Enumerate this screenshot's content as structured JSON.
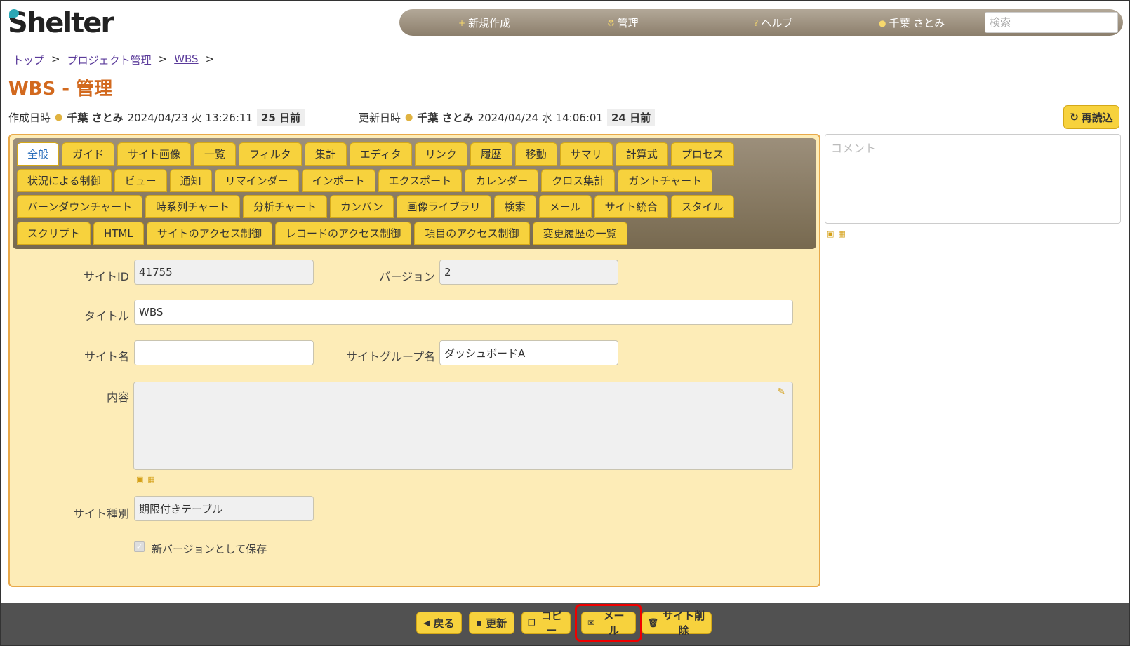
{
  "app": {
    "logo": "Shelter"
  },
  "topnav": {
    "new_label": "新規作成",
    "manage_label": "管理",
    "help_label": "ヘルプ",
    "user_label": "千葉 さとみ",
    "search_placeholder": "検索"
  },
  "breadcrumb": [
    "トップ",
    "プロジェクト管理",
    "WBS"
  ],
  "breadcrumb_sep": ">",
  "page_title": "WBS - 管理",
  "meta": {
    "created_label": "作成日時",
    "created_user": "千葉 さとみ",
    "created_at": "2024/04/23 火 13:26:11",
    "created_ago": "25 日前",
    "updated_label": "更新日時",
    "updated_user": "千葉 さとみ",
    "updated_at": "2024/04/24 水 14:06:01",
    "updated_ago": "24 日前"
  },
  "reload_label": "再読込",
  "tabs": {
    "row1": [
      "全般",
      "ガイド",
      "サイト画像",
      "一覧",
      "フィルタ",
      "集計",
      "エディタ",
      "リンク",
      "履歴",
      "移動",
      "サマリ",
      "計算式",
      "プロセス"
    ],
    "row2": [
      "状況による制御",
      "ビュー",
      "通知",
      "リマインダー",
      "インポート",
      "エクスポート",
      "カレンダー",
      "クロス集計",
      "ガントチャート"
    ],
    "row3": [
      "バーンダウンチャート",
      "時系列チャート",
      "分析チャート",
      "カンバン",
      "画像ライブラリ",
      "検索",
      "メール",
      "サイト統合",
      "スタイル"
    ],
    "row4": [
      "スクリプト",
      "HTML",
      "サイトのアクセス制御",
      "レコードのアクセス制御",
      "項目のアクセス制御",
      "変更履歴の一覧"
    ],
    "active": "全般"
  },
  "form": {
    "site_id_label": "サイトID",
    "site_id_value": "41755",
    "version_label": "バージョン",
    "version_value": "2",
    "title_label": "タイトル",
    "title_value": "WBS",
    "site_name_label": "サイト名",
    "site_name_value": "",
    "site_group_label": "サイトグループ名",
    "site_group_value": "ダッシュボードA",
    "content_label": "内容",
    "site_type_label": "サイト種別",
    "site_type_value": "期限付きテーブル",
    "save_version_label": "新バージョンとして保存",
    "save_version_checked": true
  },
  "comment_placeholder": "コメント",
  "footer": {
    "back_label": "戻る",
    "update_label": "更新",
    "copy_label": "コピー",
    "mail_label": "メール",
    "delete_label": "サイト削除"
  },
  "colors": {
    "accent": "#f7d23d",
    "title": "#d2691e",
    "highlight": "#e00000"
  }
}
